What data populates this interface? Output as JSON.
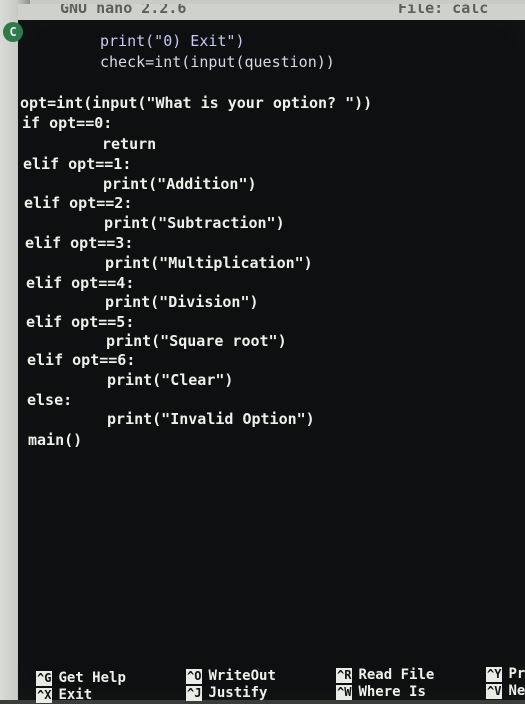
{
  "titlebar": {
    "app": "GNU nano 2.2.6",
    "file": "File: calc"
  },
  "code_lines": [
    "print(\"0) Exit\")",
    "check=int(input(question))",
    "opt=int(input(\"What is your option? \"))",
    "if opt==0:",
    "return",
    "elif opt==1:",
    "print(\"Addition\")",
    "elif opt==2:",
    "print(\"Subtraction\")",
    "elif opt==3:",
    "print(\"Multiplication\")",
    "elif opt==4:",
    "print(\"Division\")",
    "elif opt==5:",
    "print(\"Square root\")",
    "elif opt==6:",
    "print(\"Clear\")",
    "else:",
    "print(\"Invalid Option\")",
    "main()"
  ],
  "shortcuts": [
    {
      "key": "^G",
      "label": "Get Help"
    },
    {
      "key": "^X",
      "label": "Exit"
    },
    {
      "key": "^O",
      "label": "WriteOut"
    },
    {
      "key": "^J",
      "label": "Justify"
    },
    {
      "key": "^R",
      "label": "Read File"
    },
    {
      "key": "^W",
      "label": "Where Is"
    },
    {
      "key": "^Y",
      "label": "Pr"
    },
    {
      "key": "^V",
      "label": "Ne"
    }
  ]
}
